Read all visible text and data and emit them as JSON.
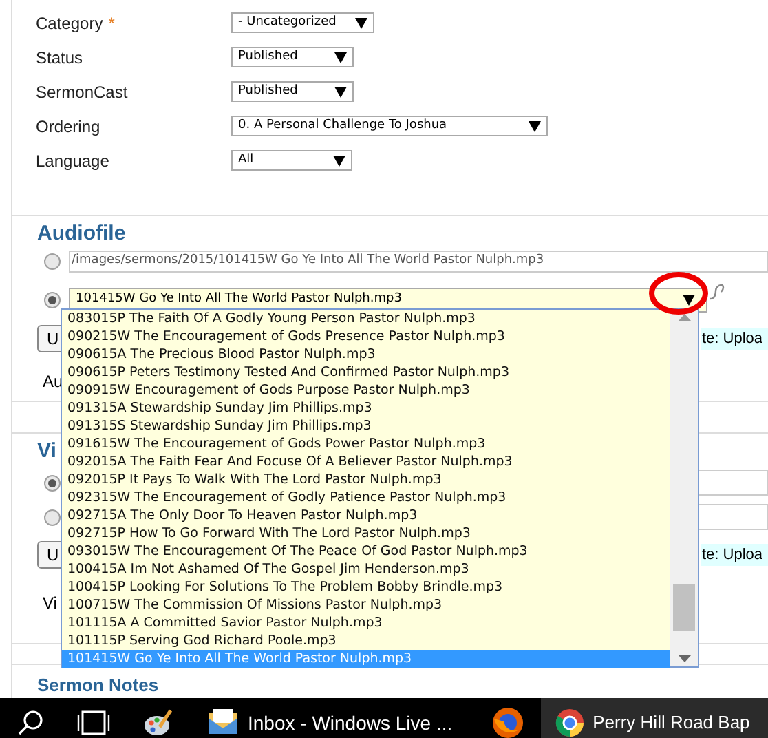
{
  "fields": [
    {
      "label": "Category",
      "required_mark": "*",
      "value": "- Uncategorized"
    },
    {
      "label": "Status",
      "value": "Published"
    },
    {
      "label": "SermonCast",
      "value": "Published"
    },
    {
      "label": "Ordering",
      "value": "0. A Personal Challenge To Joshua"
    },
    {
      "label": "Language",
      "value": "All"
    }
  ],
  "audiofile": {
    "legend": "Audiofile",
    "options": [
      {
        "kind": "text",
        "selected": false,
        "value": "/images/sermons/2015/101415W Go Ye Into All The World Pastor Nulph.mp3"
      },
      {
        "kind": "select",
        "selected": true,
        "value": "101415W Go Ye Into All The World Pastor Nulph.mp3"
      }
    ],
    "upload_button": "U",
    "note": "te: Uploa",
    "label": "Au",
    "dropdown": [
      {
        "label": "083015P The Faith Of A Godly Young Person Pastor Nulph.mp3",
        "selected": false
      },
      {
        "label": "090215W The Encouragement of Gods Presence Pastor Nulph.mp3",
        "selected": false
      },
      {
        "label": "090615A The Precious Blood Pastor Nulph.mp3",
        "selected": false
      },
      {
        "label": "090615P Peters Testimony Tested And Confirmed Pastor Nulph.mp3",
        "selected": false
      },
      {
        "label": "090915W Encouragement of Gods Purpose Pastor Nulph.mp3",
        "selected": false
      },
      {
        "label": "091315A Stewardship Sunday Jim Phillips.mp3",
        "selected": false
      },
      {
        "label": "091315S Stewardship Sunday Jim Phillips.mp3",
        "selected": false
      },
      {
        "label": "091615W The Encouragement of Gods Power Pastor Nulph.mp3",
        "selected": false
      },
      {
        "label": "092015A The Faith Fear And Focuse Of A Believer Pastor Nulph.mp3",
        "selected": false
      },
      {
        "label": "092015P It Pays To Walk With The Lord Pastor Nulph.mp3",
        "selected": false
      },
      {
        "label": "092315W The Encouragement of Godly Patience Pastor Nulph.mp3",
        "selected": false
      },
      {
        "label": "092715A The Only Door To Heaven Pastor Nulph.mp3",
        "selected": false
      },
      {
        "label": "092715P How To Go Forward With The Lord Pastor Nulph.mp3",
        "selected": false
      },
      {
        "label": "093015W The Encouragement Of The Peace Of God Pastor Nulph.mp3",
        "selected": false
      },
      {
        "label": "100415A Im Not Ashamed Of The Gospel Jim Henderson.mp3",
        "selected": false
      },
      {
        "label": "100415P Looking For Solutions To The Problem Bobby Brindle.mp3",
        "selected": false
      },
      {
        "label": "100715W The Commission Of Missions Pastor Nulph.mp3",
        "selected": false
      },
      {
        "label": "101115A A Committed Savior Pastor Nulph.mp3",
        "selected": false
      },
      {
        "label": "101115P Serving God Richard Poole.mp3",
        "selected": false
      },
      {
        "label": "101415W Go Ye Into All The World Pastor Nulph.mp3",
        "selected": true
      }
    ]
  },
  "video": {
    "legend": "Vi",
    "options": [
      {
        "kind": "text",
        "selected": true
      },
      {
        "kind": "text",
        "selected": false
      }
    ],
    "upload_button": "U",
    "note": "te: Uploa",
    "label": "Vi"
  },
  "sermon_notes": {
    "legend": "Sermon Notes"
  },
  "taskbar": [
    {
      "kind": "search",
      "active": false
    },
    {
      "kind": "taskview",
      "active": false
    },
    {
      "kind": "paint",
      "active": false
    },
    {
      "kind": "mail",
      "label": "Inbox - Windows Live ...",
      "active": false
    },
    {
      "kind": "firefox",
      "active": false
    },
    {
      "kind": "chrome",
      "label": "Perry Hill Road Bap",
      "active": true
    }
  ]
}
